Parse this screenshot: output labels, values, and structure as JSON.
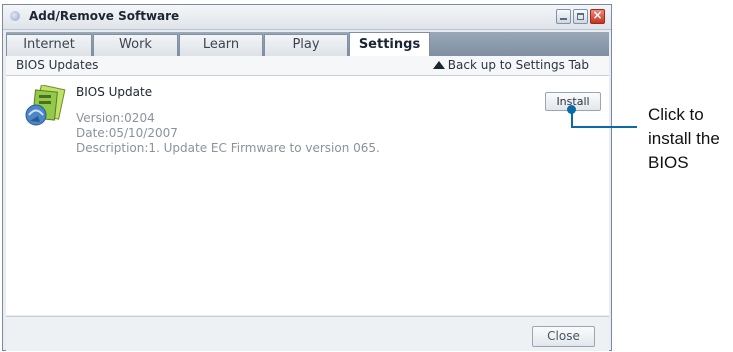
{
  "window": {
    "title": "Add/Remove Software"
  },
  "tabs": [
    {
      "label": "Internet"
    },
    {
      "label": "Work"
    },
    {
      "label": "Learn"
    },
    {
      "label": "Play"
    },
    {
      "label": "Settings",
      "active": true
    }
  ],
  "subbar": {
    "section": "BIOS Updates",
    "back_link": "Back up to Settings Tab"
  },
  "item": {
    "title": "BIOS Update",
    "version": "Version:0204",
    "date": "Date:05/10/2007",
    "description": "Description:1. Update EC Firmware to version 065.",
    "install_label": "Install",
    "icon": "software-package-icon"
  },
  "footer": {
    "close_label": "Close"
  },
  "callout": {
    "lines": [
      "Click to",
      "install the",
      "BIOS"
    ],
    "color": "#0a6aa8"
  }
}
